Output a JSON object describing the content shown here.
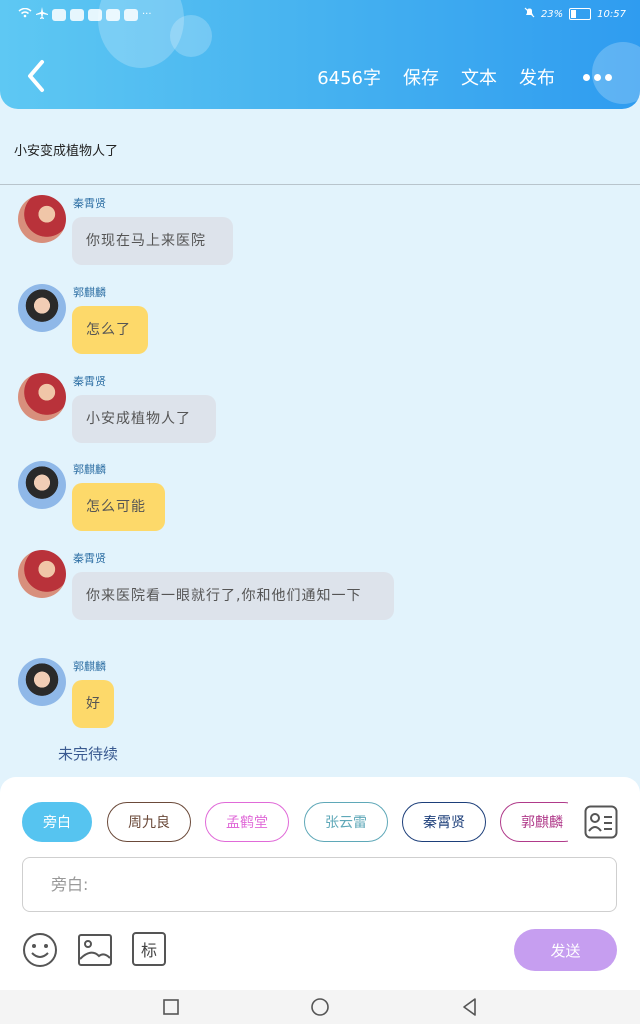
{
  "status_bar": {
    "battery": "23%",
    "time": "10:57"
  },
  "header": {
    "word_count": "6456字",
    "save_label": "保存",
    "text_label": "文本",
    "publish_label": "发布"
  },
  "subtitle": "小安变成植物人了",
  "messages": [
    {
      "sender": "秦霄贤",
      "text": "你现在马上来医院",
      "avatar": "qin-avatar",
      "color": "gray"
    },
    {
      "sender": "郭麒麟",
      "text": "怎么了",
      "avatar": "guo-avatar",
      "color": "yellow"
    },
    {
      "sender": "秦霄贤",
      "text": "小安成植物人了",
      "avatar": "qin-avatar",
      "color": "gray"
    },
    {
      "sender": "郭麒麟",
      "text": "怎么可能",
      "avatar": "guo-avatar",
      "color": "yellow"
    },
    {
      "sender": "秦霄贤",
      "text": "你来医院看一眼就行了,你和他们通知一下",
      "avatar": "qin-avatar",
      "color": "gray"
    },
    {
      "sender": "郭麒麟",
      "text": "好",
      "avatar": "guo-avatar",
      "color": "yellow"
    }
  ],
  "unfinished_label": "未完待续",
  "roles": [
    {
      "label": "旁白",
      "color": "#56c4f0",
      "active": true
    },
    {
      "label": "周九良",
      "color": "#6b4a3a"
    },
    {
      "label": "孟鹤堂",
      "color": "#e06ad8"
    },
    {
      "label": "张云雷",
      "color": "#5fa8b8"
    },
    {
      "label": "秦霄贤",
      "color": "#1d3f7a"
    },
    {
      "label": "郭麒麟",
      "color": "#b03a8a"
    }
  ],
  "input": {
    "placeholder": "旁白:"
  },
  "mark_label": "标",
  "send_label": "发送"
}
